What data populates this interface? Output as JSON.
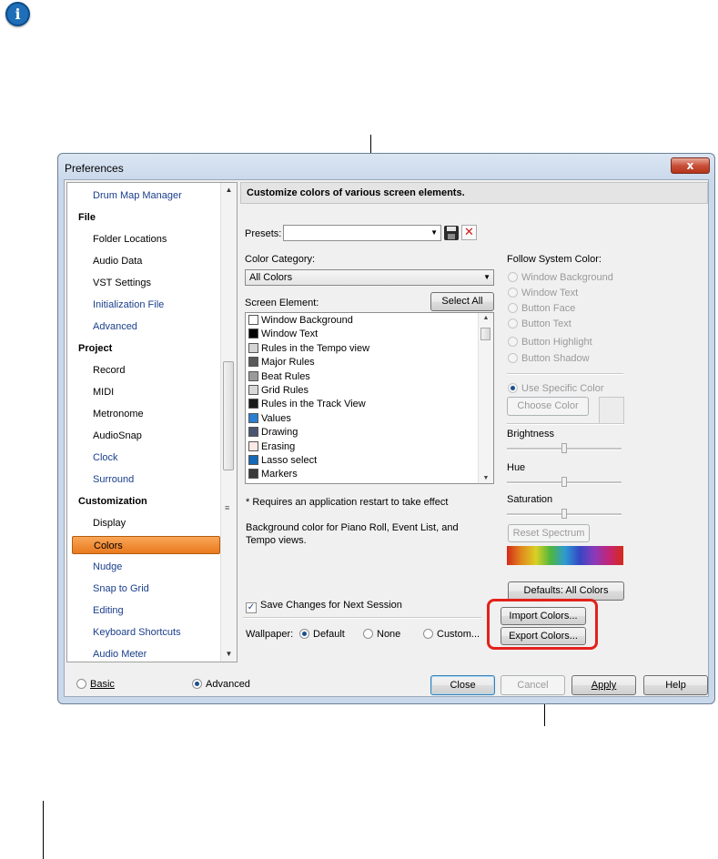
{
  "window": {
    "title": "Preferences",
    "close_glyph": "x"
  },
  "info_icon": {
    "glyph": "i",
    "icon": "info-icon"
  },
  "tree": {
    "items": [
      {
        "label": "Drum Map Manager",
        "kind": "sub",
        "link": true
      },
      {
        "label": "File",
        "kind": "cat"
      },
      {
        "label": "Folder Locations",
        "kind": "sub"
      },
      {
        "label": "Audio Data",
        "kind": "sub"
      },
      {
        "label": "VST Settings",
        "kind": "sub"
      },
      {
        "label": "Initialization File",
        "kind": "sub",
        "link": true
      },
      {
        "label": "Advanced",
        "kind": "sub",
        "link": true
      },
      {
        "label": "Project",
        "kind": "cat"
      },
      {
        "label": "Record",
        "kind": "sub"
      },
      {
        "label": "MIDI",
        "kind": "sub"
      },
      {
        "label": "Metronome",
        "kind": "sub"
      },
      {
        "label": "AudioSnap",
        "kind": "sub"
      },
      {
        "label": "Clock",
        "kind": "sub",
        "link": true
      },
      {
        "label": "Surround",
        "kind": "sub",
        "link": true
      },
      {
        "label": "Customization",
        "kind": "cat"
      },
      {
        "label": "Display",
        "kind": "sub"
      },
      {
        "label": "Colors",
        "kind": "sub",
        "selected": true
      },
      {
        "label": "Nudge",
        "kind": "sub",
        "link": true
      },
      {
        "label": "Snap to Grid",
        "kind": "sub",
        "link": true
      },
      {
        "label": "Editing",
        "kind": "sub",
        "link": true
      },
      {
        "label": "Keyboard Shortcuts",
        "kind": "sub",
        "link": true
      },
      {
        "label": "Audio Meter",
        "kind": "sub",
        "link": true
      }
    ]
  },
  "header": {
    "title": "Customize colors of various screen elements."
  },
  "presets": {
    "label": "Presets:",
    "value": ""
  },
  "color_category": {
    "label": "Color Category:",
    "value": "All Colors"
  },
  "screen_element": {
    "label": "Screen Element:",
    "select_all": "Select All",
    "items": [
      {
        "label": "Window Background",
        "color": "#ffffff"
      },
      {
        "label": "Window Text",
        "color": "#000000"
      },
      {
        "label": "Rules in the Tempo view",
        "color": "#d4d4d4"
      },
      {
        "label": "Major Rules",
        "color": "#5a5a5a"
      },
      {
        "label": "Beat Rules",
        "color": "#9a9a9a"
      },
      {
        "label": "Grid Rules",
        "color": "#d8d8d8"
      },
      {
        "label": "Rules in the Track View",
        "color": "#1a1a1a"
      },
      {
        "label": "Values",
        "color": "#2b7fd0"
      },
      {
        "label": "Drawing",
        "color": "#4a5570"
      },
      {
        "label": "Erasing",
        "color": "#fde9e4"
      },
      {
        "label": "Lasso select",
        "color": "#1669b7"
      },
      {
        "label": "Markers",
        "color": "#3a3a3a"
      }
    ]
  },
  "restart_note": "* Requires an application restart to take effect",
  "description": "Background color for Piano Roll, Event List, and Tempo views.",
  "save_changes": {
    "label": "Save Changes for Next Session",
    "checked": true
  },
  "wallpaper": {
    "label": "Wallpaper:",
    "options": [
      {
        "label": "Default",
        "selected": true
      },
      {
        "label": "None",
        "selected": false
      },
      {
        "label": "Custom...",
        "selected": false
      }
    ]
  },
  "follow_system": {
    "label": "Follow System Color:",
    "options": [
      "Window Background",
      "Window Text",
      "Button Face",
      "Button Text",
      "Button Highlight",
      "Button Shadow"
    ]
  },
  "use_specific": {
    "label": "Use Specific Color",
    "selected": true
  },
  "choose_color": "Choose Color",
  "sliders": [
    {
      "label": "Brightness",
      "value": 0.5
    },
    {
      "label": "Hue",
      "value": 0.5
    },
    {
      "label": "Saturation",
      "value": 0.5
    }
  ],
  "reset_spectrum": "Reset Spectrum",
  "defaults_button": "Defaults: All Colors",
  "import_button": "Import Colors...",
  "export_button": "Export Colors...",
  "mode": {
    "basic": "Basic",
    "advanced": "Advanced",
    "selected": "advanced"
  },
  "footer": {
    "close": "Close",
    "cancel": "Cancel",
    "apply": "Apply",
    "help": "Help"
  },
  "colors": {
    "selection_orange": "#f2933a",
    "callout_red": "#e3211c",
    "link_blue": "#1a3e8c"
  }
}
